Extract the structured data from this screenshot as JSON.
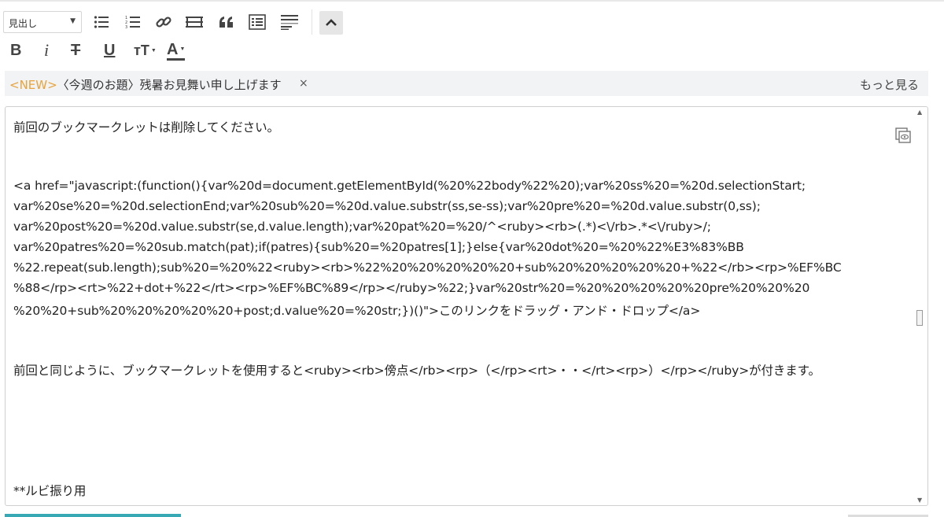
{
  "toolbar": {
    "heading_select": {
      "value": "見出し"
    },
    "row1_icons": [
      "bullet-list-icon",
      "numbered-list-icon",
      "link-icon",
      "horizontal-rule-icon",
      "quote-icon",
      "table-of-contents-icon",
      "justify-icon"
    ],
    "row2": {
      "bold": "B",
      "italic": "i",
      "strikethrough": "T",
      "underline": "U",
      "font_size": "тT",
      "font_color": "A"
    }
  },
  "topic": {
    "new_tag": "<NEW>",
    "text": "〈今週のお題〉残暑お見舞い申し上げます",
    "close": "×",
    "more_link": "もっと見る",
    "new_color": "#e8a33d"
  },
  "editor": {
    "lines": [
      "前回のブックマークレットは削除してください。",
      "<a href=\"javascript:(function(){var%20d=document.getElementById(%20%22body%22%20);var%20ss%20=%20d.selectionStart;",
      "var%20se%20=%20d.selectionEnd;var%20sub%20=%20d.value.substr(ss,se-ss);var%20pre%20=%20d.value.substr(0,ss);",
      "var%20post%20=%20d.value.substr(se,d.value.length);var%20pat%20=%20/^<ruby><rb>(.*)<\\/rb>.*<\\/ruby>/;",
      "var%20patres%20=%20sub.match(pat);if(patres){sub%20=%20patres[1];}else{var%20dot%20=%20%22%E3%83%BB",
      "%22.repeat(sub.length);sub%20=%20%22<ruby><rb>%22%20%20%20%20%20+sub%20%20%20%20%20+%22</rb><rp>%EF%BC",
      "%88</rp><rt>%22+dot+%22</rt><rp>%EF%BC%89</rp></ruby>%22;}var%20str%20=%20%20%20%20%20pre%20%20%20",
      "%20%20+sub%20%20%20%20%20+post;d.value%20=%20str;})()\">このリンクをドラッグ・アンド・ドロップ</a>",
      "前回と同じように、ブックマークレットを使用すると<ruby><rb>傍点</rb><rp>（</rp><rt>・・</rt><rp>）</rp></ruby>が付きます。",
      "**ルビ振り用"
    ]
  }
}
